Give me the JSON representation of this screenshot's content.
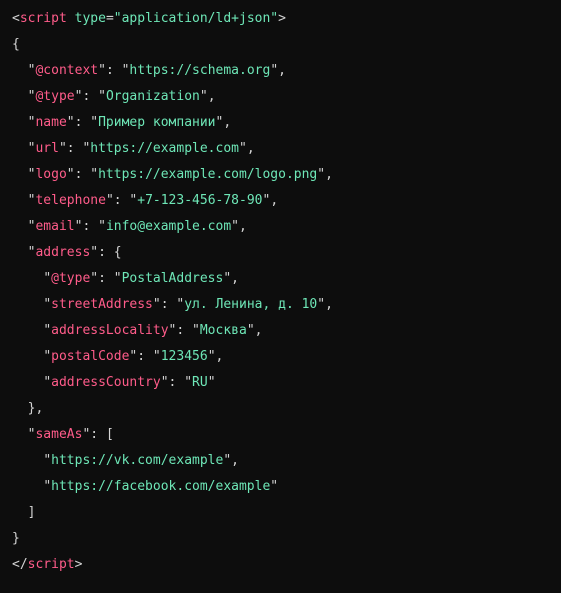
{
  "tag": {
    "open_lt": "<",
    "name": "script",
    "attr_name": "type",
    "eq": "=",
    "attr_value": "\"application/ld+json\"",
    "open_gt": ">",
    "close": "</",
    "close_gt": ">"
  },
  "colon": ": ",
  "comma": ",",
  "q": "\"",
  "brace_open": "{",
  "brace_close": "}",
  "bracket_open": "[",
  "bracket_close": "]",
  "json_data": {
    "context_key": "@context",
    "context_val": "https://schema.org",
    "type_key": "@type",
    "type_val": "Organization",
    "name_key": "name",
    "name_val": "Пример компании",
    "url_key": "url",
    "url_val": "https://example.com",
    "logo_key": "logo",
    "logo_val": "https://example.com/logo.png",
    "telephone_key": "telephone",
    "telephone_val": "+7-123-456-78-90",
    "email_key": "email",
    "email_val": "info@example.com",
    "address_key": "address",
    "addr_type_key": "@type",
    "addr_type_val": "PostalAddress",
    "street_key": "streetAddress",
    "street_val": "ул. Ленина, д. 10",
    "locality_key": "addressLocality",
    "locality_val": "Москва",
    "postal_key": "postalCode",
    "postal_val": "123456",
    "country_key": "addressCountry",
    "country_val": "RU",
    "sameas_key": "sameAs",
    "sameas_0": "https://vk.com/example",
    "sameas_1": "https://facebook.com/example"
  }
}
